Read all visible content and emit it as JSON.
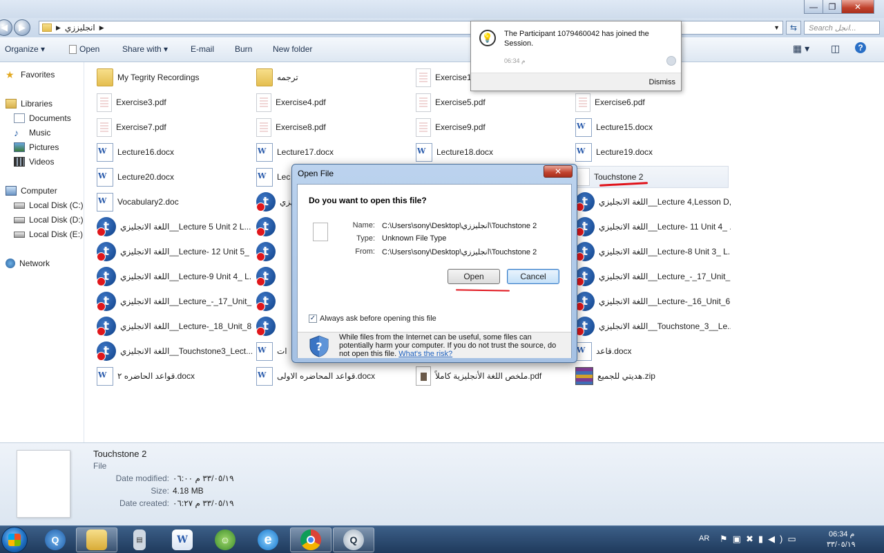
{
  "window": {
    "address_path": "انجليززي",
    "search_placeholder": "Search انجل...",
    "min_label": "—",
    "max_label": "❐",
    "close_label": "✕"
  },
  "toolbar": {
    "organize": "Organize ▾",
    "open": "Open",
    "share_with": "Share with ▾",
    "email": "E-mail",
    "burn": "Burn",
    "new_folder": "New folder"
  },
  "nav": {
    "favorites": "Favorites",
    "libraries": "Libraries",
    "documents": "Documents",
    "music": "Music",
    "pictures": "Pictures",
    "videos": "Videos",
    "computer": "Computer",
    "disk_c": "Local Disk (C:)",
    "disk_d": "Local Disk (D:)",
    "disk_e": "Local Disk (E:)",
    "network": "Network"
  },
  "files": [
    {
      "name": "My Tegrity Recordings",
      "icon": "folder"
    },
    {
      "name": "ترجمه",
      "icon": "folder"
    },
    {
      "name": "Exercise1",
      "icon": "pdf"
    },
    {
      "name": "",
      "icon": "none"
    },
    {
      "name": "Exercise3.pdf",
      "icon": "pdf"
    },
    {
      "name": "Exercise4.pdf",
      "icon": "pdf"
    },
    {
      "name": "Exercise5.pdf",
      "icon": "pdf"
    },
    {
      "name": "Exercise6.pdf",
      "icon": "pdf"
    },
    {
      "name": "Exercise7.pdf",
      "icon": "pdf"
    },
    {
      "name": "Exercise8.pdf",
      "icon": "pdf"
    },
    {
      "name": "Exercise9.pdf",
      "icon": "pdf"
    },
    {
      "name": "Lecture15.docx",
      "icon": "doc"
    },
    {
      "name": "Lecture16.docx",
      "icon": "doc"
    },
    {
      "name": "Lecture17.docx",
      "icon": "doc"
    },
    {
      "name": "Lecture18.docx",
      "icon": "doc"
    },
    {
      "name": "Lecture19.docx",
      "icon": "doc"
    },
    {
      "name": "Lecture20.docx",
      "icon": "doc"
    },
    {
      "name": "Lec",
      "icon": "doc"
    },
    {
      "name": "",
      "icon": "none"
    },
    {
      "name": "Touchstone 2",
      "icon": "blank"
    },
    {
      "name": "Vocabulary2.doc",
      "icon": "doc"
    },
    {
      "name": "اللغة الانجليزي",
      "icon": "t"
    },
    {
      "name": "",
      "icon": "none"
    },
    {
      "name": "اللغة الانجليزي__Lecture 4,Lesson D,...",
      "icon": "t"
    },
    {
      "name": "اللغة الانجليزي__Lecture 5  Unit 2  L...",
      "icon": "t"
    },
    {
      "name": "",
      "icon": "t"
    },
    {
      "name": "",
      "icon": "none"
    },
    {
      "name": "اللغة الانجليزي__Lecture- 11 Unit 4_ ...",
      "icon": "t"
    },
    {
      "name": "اللغة الانجليزي__Lecture- 12 Unit 5_ ...",
      "icon": "t"
    },
    {
      "name": "",
      "icon": "t"
    },
    {
      "name": "",
      "icon": "none"
    },
    {
      "name": "اللغة الانجليزي__Lecture-8  Unit 3_ L...",
      "icon": "t"
    },
    {
      "name": "اللغة الانجليزي__Lecture-9 Unit 4_ L...",
      "icon": "t"
    },
    {
      "name": "",
      "icon": "t"
    },
    {
      "name": "",
      "icon": "none"
    },
    {
      "name": "اللغة الانجليزي__Lecture_-_17_Unit_...",
      "icon": "t"
    },
    {
      "name": "اللغة الانجليزي__Lecture_-_17_Unit_...",
      "icon": "t"
    },
    {
      "name": "",
      "icon": "t"
    },
    {
      "name": "",
      "icon": "none"
    },
    {
      "name": "اللغة الانجليزي__Lecture-_16_Unit_6...",
      "icon": "t"
    },
    {
      "name": "اللغة الانجليزي__Lecture-_18_Unit_8...",
      "icon": "t"
    },
    {
      "name": "",
      "icon": "t"
    },
    {
      "name": "",
      "icon": "none"
    },
    {
      "name": "اللغة الانجليزي__Touchstone_3__Le...",
      "icon": "t"
    },
    {
      "name": "اللغة الانجليزي__Touchstone3_Lect...",
      "icon": "t"
    },
    {
      "name": "ات",
      "icon": "doc"
    },
    {
      "name": "",
      "icon": "none"
    },
    {
      "name": "قاعد.docx",
      "icon": "doc"
    },
    {
      "name": "قواعد الحاضره ٢.docx",
      "icon": "doc"
    },
    {
      "name": "قواعد المحاضره الاولى.docx",
      "icon": "doc"
    },
    {
      "name": "ملخص اللغة الأنجليزية كاملاً.pdf",
      "icon": "img"
    },
    {
      "name": "هديتي للجميع.zip",
      "icon": "zip"
    }
  ],
  "details": {
    "name": "Touchstone 2",
    "type": "File",
    "modified_label": "Date modified:",
    "modified_value": "٣٣/٠٥/١٩ م ٠٦:٠٠",
    "size_label": "Size:",
    "size_value": "4.18 MB",
    "created_label": "Date created:",
    "created_value": "٣٣/٠٥/١٩ م ٠٦:٢٧"
  },
  "notification": {
    "message": "The Participant 1079460042 has joined the Session.",
    "time": "06:34 م",
    "dismiss": "Dismiss"
  },
  "dialog": {
    "title": "Open File",
    "close": "✕",
    "question": "Do you want to open this file?",
    "name_label": "Name:",
    "name_value": "C:\\Users\\sony\\Desktop\\انجليززي\\Touchstone 2",
    "type_label": "Type:",
    "type_value": "Unknown File Type",
    "from_label": "From:",
    "from_value": "C:\\Users\\sony\\Desktop\\انجليززي\\Touchstone 2",
    "open_button": "Open",
    "cancel_button": "Cancel",
    "checkbox_label": "Always ask before opening this file",
    "warning_text": "While files from the Internet can be useful, some files can potentially harm your computer. If you do not trust the source, do not open this file.",
    "risk_link": "What's the risk?"
  },
  "taskbar": {
    "lang": "AR",
    "time": "06:34 م",
    "date": "٣٣/٠٥/١٩"
  },
  "colors": {
    "accent": "#3b7bc4",
    "annotation_red": "#e0121a"
  }
}
